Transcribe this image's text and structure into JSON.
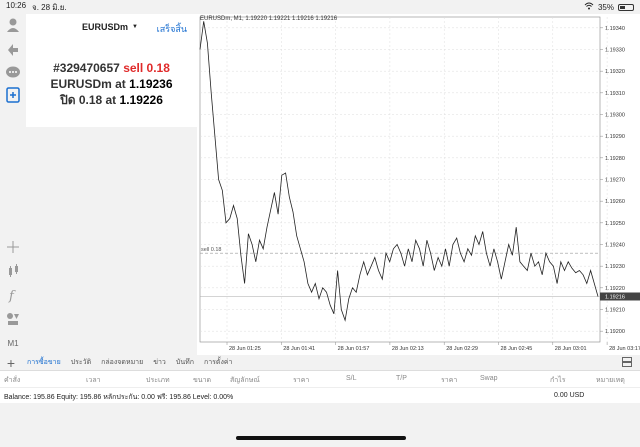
{
  "status_bar": {
    "time": "10:26",
    "date": "จ. 28 มิ.ย.",
    "battery": "35%"
  },
  "trade_panel": {
    "symbol": "EURUSDm",
    "done_label": "เสร็จสิ้น",
    "order_id": "#329470657",
    "order_side": "sell 0.18",
    "symbol_at_label": "EURUSDm at",
    "open_price": "1.19236",
    "close_label": "ปิด 0.18 at",
    "close_price": "1.19226"
  },
  "toolbar": {
    "timeframe_label": "M1"
  },
  "chart": {
    "title": "EURUSDm, M1, 1.19220 1.19221 1.19216 1.19216",
    "order_line_label": "sell 0.18",
    "current_price_label": "1.19216"
  },
  "chart_data": {
    "type": "line",
    "x_ticks": [
      "28 Jun 01:25",
      "28 Jun 01:41",
      "28 Jun 01:57",
      "28 Jun 02:13",
      "28 Jun 02:29",
      "28 Jun 02:45",
      "28 Jun 03:01",
      "28 Jun 03:17"
    ],
    "y_ticks": [
      "1.19340",
      "1.19330",
      "1.19320",
      "1.19310",
      "1.19300",
      "1.19290",
      "1.19280",
      "1.19270",
      "1.19260",
      "1.19250",
      "1.19240",
      "1.19230",
      "1.19220",
      "1.19210",
      "1.19200"
    ],
    "ylim": [
      1.19195,
      1.19345
    ],
    "order_line": 1.19236,
    "current_price": 1.19216,
    "values": [
      1.1933,
      1.19343,
      1.19333,
      1.1931,
      1.1929,
      1.1927,
      1.19265,
      1.1925,
      1.19252,
      1.19258,
      1.19252,
      1.19235,
      1.19222,
      1.19245,
      1.1924,
      1.19232,
      1.19242,
      1.19238,
      1.19248,
      1.19256,
      1.19264,
      1.19254,
      1.19272,
      1.19273,
      1.19262,
      1.19255,
      1.19244,
      1.19238,
      1.19232,
      1.19222,
      1.19218,
      1.19222,
      1.19215,
      1.1922,
      1.19218,
      1.19212,
      1.19208,
      1.19228,
      1.1921,
      1.19205,
      1.19215,
      1.1922,
      1.19218,
      1.19226,
      1.19232,
      1.19226,
      1.1923,
      1.19234,
      1.19228,
      1.19224,
      1.19236,
      1.19232,
      1.19238,
      1.1924,
      1.19236,
      1.1923,
      1.19238,
      1.19232,
      1.19242,
      1.19238,
      1.1923,
      1.19242,
      1.19236,
      1.19228,
      1.19234,
      1.1923,
      1.19238,
      1.1923,
      1.1924,
      1.19243,
      1.19236,
      1.19232,
      1.19238,
      1.19235,
      1.19244,
      1.1924,
      1.19246,
      1.19236,
      1.1923,
      1.19238,
      1.19232,
      1.19224,
      1.19232,
      1.1924,
      1.19235,
      1.19248,
      1.19232,
      1.1923,
      1.19228,
      1.19236,
      1.1923,
      1.19232,
      1.19226,
      1.19236,
      1.19232,
      1.1923,
      1.19222,
      1.19232,
      1.19228,
      1.19232,
      1.19229,
      1.19227,
      1.19228,
      1.19226,
      1.19222,
      1.19228,
      1.19222,
      1.19216
    ]
  },
  "bottom_tabs": [
    "การซื้อขาย",
    "ประวัติ",
    "กล่องจดหมาย",
    "ข่าว",
    "บันทึก",
    "การตั้งค่า"
  ],
  "table_header": [
    "คำสั่ง",
    "เวลา",
    "ประเภท",
    "ขนาด",
    "สัญลักษณ์",
    "ราคา",
    "S/L",
    "T/P",
    "ราคา",
    "Swap",
    "กำไร",
    "หมายเหตุ"
  ],
  "balance_row": {
    "text": "Balance: 195.86 Equity: 195.86 หลักประกัน: 0.00 ฟรี: 195.86 Level: 0.00%",
    "amount": "0.00  USD"
  }
}
